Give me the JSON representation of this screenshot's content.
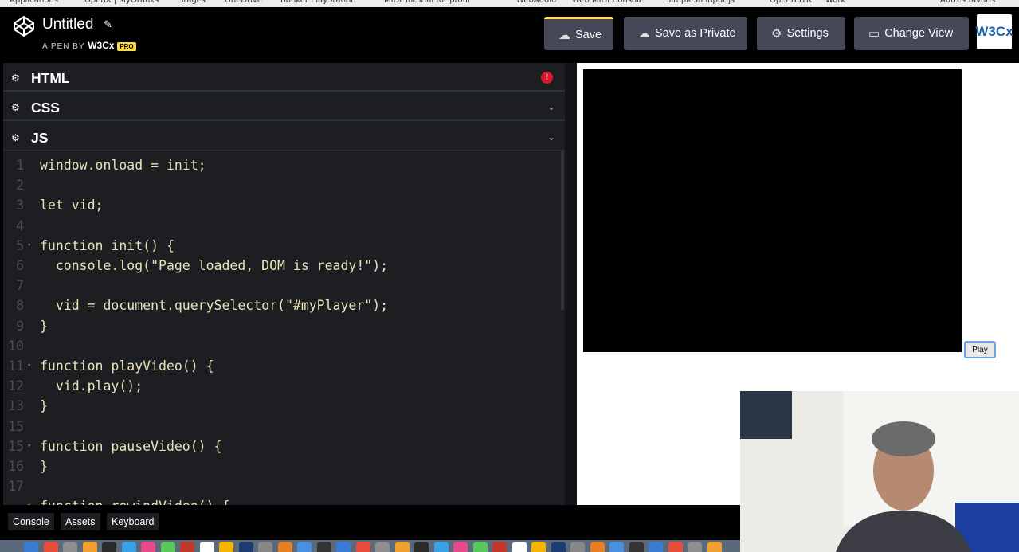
{
  "bookmarks": [
    "Applications",
    "OpenX | MyOranks",
    "Stages",
    "OneDrive",
    "Bonker PlayStation",
    "MIDI Tutorial for profil",
    "WebAudio",
    "Web MIDI Console",
    "Simple.ai.input.js",
    "OpenBSTR",
    "Work",
    "Autres favoris"
  ],
  "header": {
    "title": "Untitled",
    "byline_prefix": "A PEN BY",
    "author": "W3Cx",
    "pro_badge": "PRO",
    "buttons": {
      "save": "Save",
      "save_private": "Save as Private",
      "settings": "Settings",
      "change_view": "Change View"
    },
    "avatar_text": "W3Cx"
  },
  "editors": {
    "html_label": "HTML",
    "css_label": "CSS",
    "js_label": "JS",
    "html_error": "!"
  },
  "code": {
    "lines": [
      {
        "n": "1",
        "text": "window.onload = init;"
      },
      {
        "n": "2",
        "text": ""
      },
      {
        "n": "3",
        "text": "let vid;"
      },
      {
        "n": "4",
        "text": ""
      },
      {
        "n": "5",
        "text": "function init() {"
      },
      {
        "n": "6",
        "text": "  console.log(\"Page loaded, DOM is ready!\");"
      },
      {
        "n": "7",
        "text": ""
      },
      {
        "n": "8",
        "text": "  vid = document.querySelector(\"#myPlayer\");"
      },
      {
        "n": "9",
        "text": "}"
      },
      {
        "n": "10",
        "text": ""
      },
      {
        "n": "11",
        "text": "function playVideo() {"
      },
      {
        "n": "12",
        "text": "  vid.play();"
      },
      {
        "n": "13",
        "text": "}"
      },
      {
        "n": "15",
        "text": ""
      },
      {
        "n": "15",
        "text": "function pauseVideo() {"
      },
      {
        "n": "16",
        "text": "}"
      },
      {
        "n": "17",
        "text": ""
      },
      {
        "n": "",
        "text": "function rewindVideo() {"
      }
    ]
  },
  "preview": {
    "play_label": "Play"
  },
  "bottombar": {
    "console": "Console",
    "assets": "Assets",
    "keyboard": "Keyboard"
  },
  "colors": {
    "accent": "#ffdd40",
    "editor_bg": "#1d1e22",
    "button_bg": "#444857",
    "error": "#e0162f"
  }
}
